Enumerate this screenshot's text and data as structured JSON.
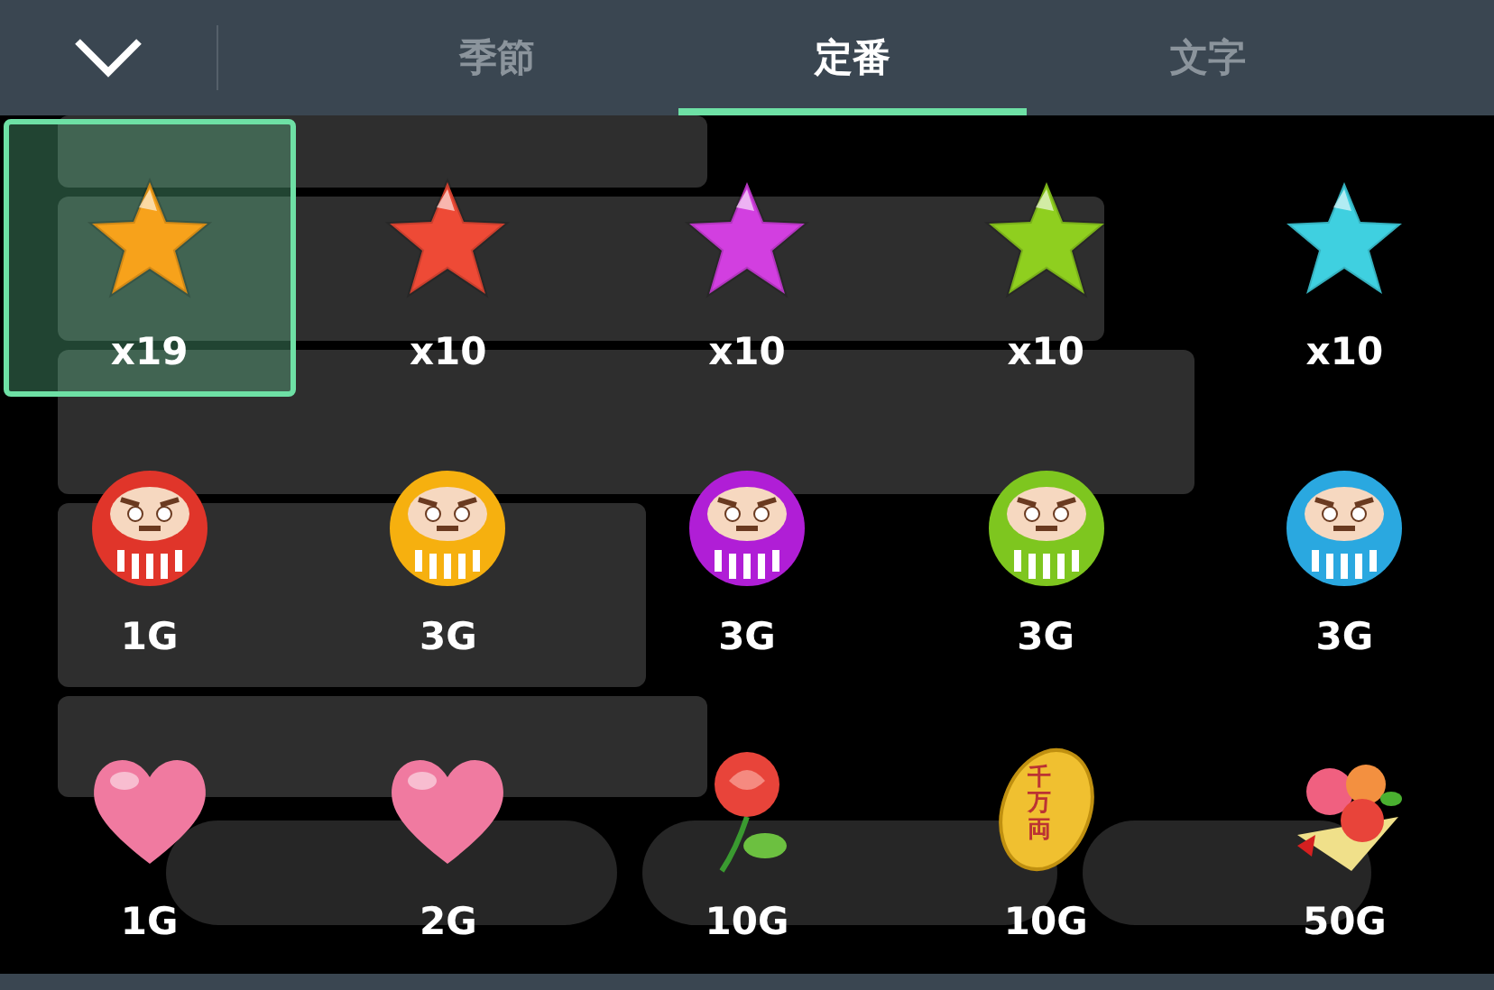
{
  "tabs": [
    {
      "label": "季節",
      "selected": false
    },
    {
      "label": "定番",
      "selected": true
    },
    {
      "label": "文字",
      "selected": false
    }
  ],
  "gifts": [
    {
      "kind": "star",
      "color": "#f7a21b",
      "label": "x19",
      "selected": true
    },
    {
      "kind": "star",
      "color": "#ee4a36",
      "label": "x10",
      "selected": false
    },
    {
      "kind": "star",
      "color": "#d23fe0",
      "label": "x10",
      "selected": false
    },
    {
      "kind": "star",
      "color": "#8fcf1f",
      "label": "x10",
      "selected": false
    },
    {
      "kind": "star",
      "color": "#3fd0e0",
      "label": "x10",
      "selected": false
    },
    {
      "kind": "daruma",
      "color": "#e0352a",
      "label": "1G",
      "selected": false
    },
    {
      "kind": "daruma",
      "color": "#f6b00f",
      "label": "3G",
      "selected": false
    },
    {
      "kind": "daruma",
      "color": "#b01ed6",
      "label": "3G",
      "selected": false
    },
    {
      "kind": "daruma",
      "color": "#7ec61f",
      "label": "3G",
      "selected": false
    },
    {
      "kind": "daruma",
      "color": "#2aa8e0",
      "label": "3G",
      "selected": false
    },
    {
      "kind": "heart",
      "color": "#f07aa0",
      "label": "1G",
      "selected": false
    },
    {
      "kind": "heart",
      "color": "#f07aa0",
      "label": "2G",
      "selected": false
    },
    {
      "kind": "rose",
      "color": "#e8443a",
      "label": "10G",
      "selected": false
    },
    {
      "kind": "koban",
      "color": "#f0c030",
      "label": "10G",
      "selected": false,
      "icon_text": "千万両"
    },
    {
      "kind": "bouquet",
      "color": "#f06080",
      "label": "50G",
      "selected": false
    }
  ]
}
